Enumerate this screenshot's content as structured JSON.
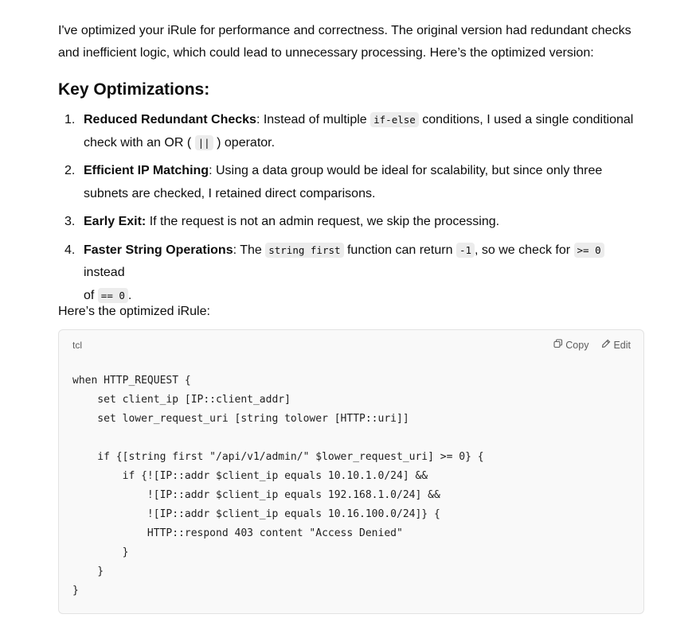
{
  "intro": {
    "line1": "I've optimized your iRule for performance and correctness. The original version had redundant checks",
    "line2": "and inefficient logic, which could lead to unnecessary processing. Here’s the optimized version:"
  },
  "heading": "Key Optimizations:",
  "items": [
    {
      "num": "1.",
      "title": "Reduced Redundant Checks",
      "text_a": ": Instead of multiple ",
      "code_a": "if-else",
      "text_b": " conditions, I used a single conditional",
      "text_c": "check with an OR ( ",
      "code_b": "||",
      "text_d": " ) operator."
    },
    {
      "num": "2.",
      "title": "Efficient IP Matching",
      "text_a": ": Using a data group would be ideal for scalability, but since only three",
      "text_b": "subnets are checked, I retained direct comparisons."
    },
    {
      "num": "3.",
      "title": "Early Exit:",
      "text_a": " If the request is not an admin request, we skip the processing."
    },
    {
      "num": "4.",
      "title": "Faster String Operations",
      "text_a": ": The ",
      "code_a": "string first",
      "text_b": " function can return ",
      "code_b": "-1",
      "text_c": ", so we check for ",
      "code_c": ">= 0",
      "text_d": " instead",
      "text_e": "of ",
      "code_d": "== 0",
      "text_f": "."
    }
  ],
  "lead": "Here’s the optimized iRule:",
  "code_block": {
    "language": "tcl",
    "copy_label": "Copy",
    "edit_label": "Edit",
    "lines": [
      "when HTTP_REQUEST {",
      "    set client_ip [IP::client_addr]",
      "    set lower_request_uri [string tolower [HTTP::uri]]",
      "",
      "    if {[string first \"/api/v1/admin/\" $lower_request_uri] >= 0} {",
      "        if {![IP::addr $client_ip equals 10.10.1.0/24] &&",
      "            ![IP::addr $client_ip equals 192.168.1.0/24] &&",
      "            ![IP::addr $client_ip equals 10.16.100.0/24]} {",
      "            HTTP::respond 403 content \"Access Denied\"",
      "        }",
      "    }",
      "}"
    ]
  },
  "icons": {
    "copy": "copy-icon",
    "edit": "edit-icon"
  }
}
